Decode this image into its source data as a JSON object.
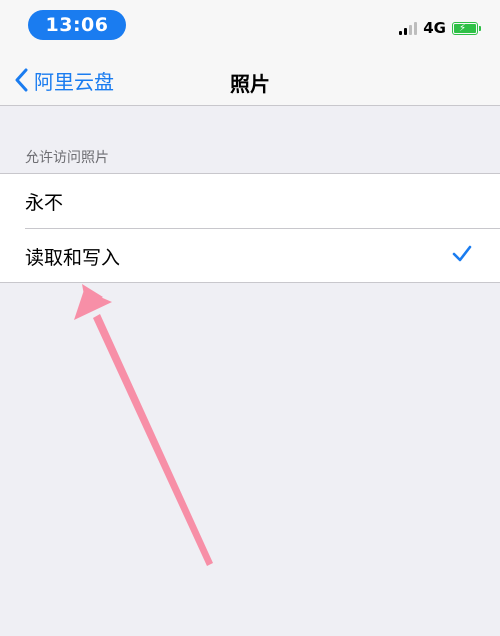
{
  "status_bar": {
    "time": "13:06",
    "network": "4G",
    "icons": [
      "signal-icon",
      "battery-charging-icon"
    ]
  },
  "nav": {
    "back_label": "阿里云盘",
    "title": "照片",
    "back_icon": "chevron-left-icon"
  },
  "section": {
    "header": "允许访问照片",
    "options": [
      {
        "label": "永不",
        "selected": false
      },
      {
        "label": "读取和写入",
        "selected": true
      }
    ]
  },
  "colors": {
    "accent": "#1a7cf0",
    "battery": "#2ec046",
    "annotation_arrow": "#f78fa7",
    "background": "#efeff4"
  }
}
